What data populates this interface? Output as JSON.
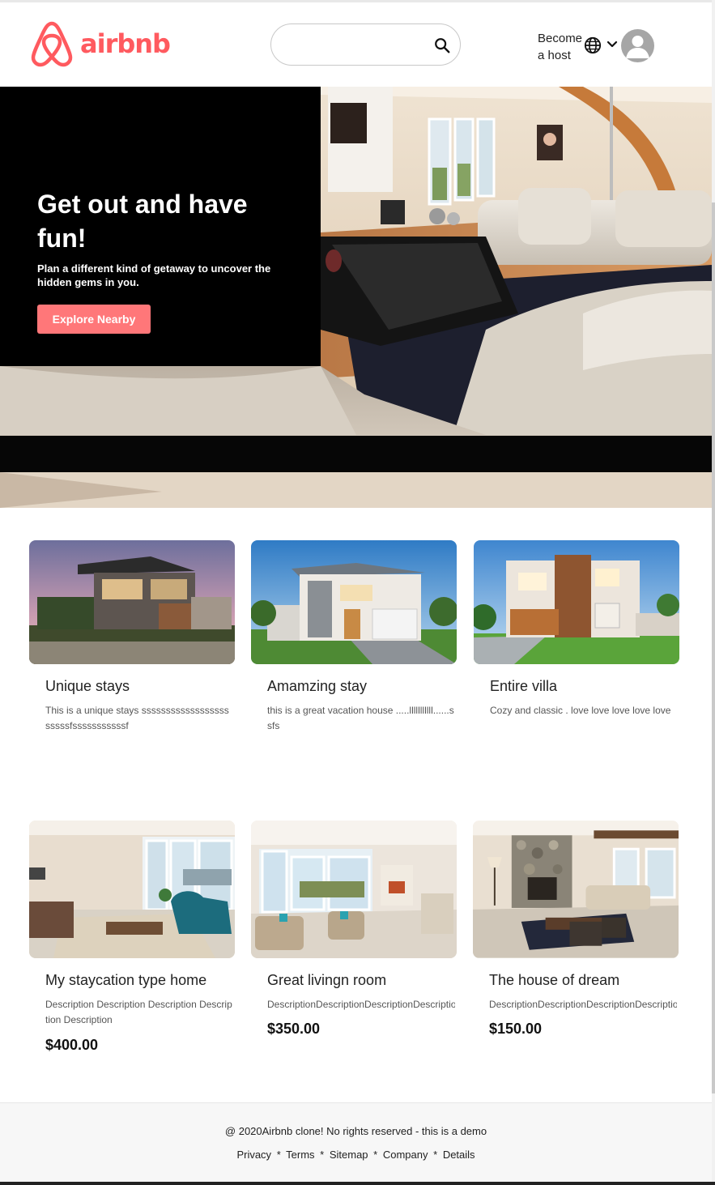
{
  "header": {
    "logo_text": "airbnb",
    "search": {
      "value": "",
      "placeholder": ""
    },
    "become_host_line1": "Become",
    "become_host_line2": "a host",
    "accent_color": "#ff5a5f"
  },
  "hero": {
    "title": "Get out and have fun!",
    "subtitle": "Plan a different kind of getaway to uncover the hidden gems in you.",
    "button_label": "Explore Nearby",
    "button_color": "#ff7779"
  },
  "cards": [
    {
      "title": "Unique stays",
      "description": "This is a unique stays sssssssssssssssssssssssfsssssssssssf",
      "price": ""
    },
    {
      "title": "Amamzing stay",
      "description": "this is a great vacation house .....lllllllllll......ssfs",
      "price": ""
    },
    {
      "title": "Entire villa",
      "description": "Cozy and classic . love love love love love",
      "price": ""
    },
    {
      "title": "My staycation type home",
      "description": "Description Description Description Description Description",
      "price": "$400.00"
    },
    {
      "title": "Great livingn room",
      "description": "DescriptionDescriptionDescriptionDescription",
      "price": "$350.00"
    },
    {
      "title": "The house of dream",
      "description": "DescriptionDescriptionDescriptionDescription",
      "price": "$150.00"
    }
  ],
  "footer": {
    "copyright": "@ 2020Airbnb clone! No rights reserved - this is a demo",
    "links": [
      "Privacy",
      "Terms",
      "Sitemap",
      "Company",
      "Details"
    ],
    "separator": "*"
  },
  "icons": [
    "airbnb-logo-icon",
    "search-icon",
    "globe-icon",
    "chevron-down-icon",
    "user-avatar-icon"
  ]
}
